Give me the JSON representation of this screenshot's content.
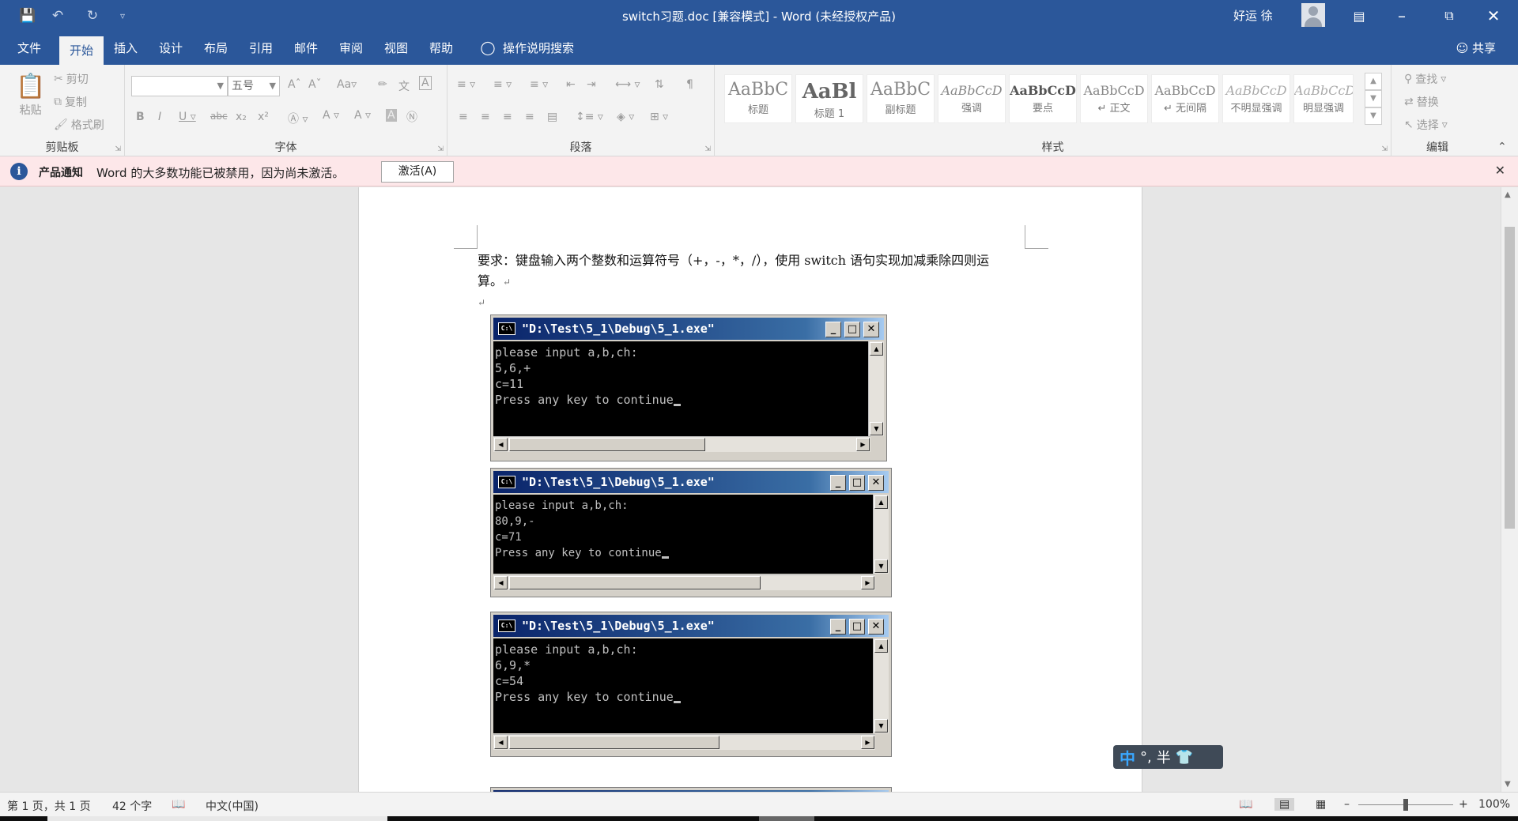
{
  "titlebar": {
    "title": "switch习题.doc [兼容模式]  -  Word (未经授权产品)",
    "user": "好运 徐",
    "qat_icons": [
      "save-icon",
      "undo-icon",
      "redo-icon",
      "customize-icon"
    ]
  },
  "menu": {
    "tabs": [
      "文件",
      "开始",
      "插入",
      "设计",
      "布局",
      "引用",
      "邮件",
      "审阅",
      "视图",
      "帮助"
    ],
    "active": "开始",
    "tellme": "操作说明搜索",
    "share": "共享"
  },
  "ribbon": {
    "clipboard": {
      "label": "剪贴板",
      "paste": "粘贴",
      "cut": "剪切",
      "copy": "复制",
      "format_painter": "格式刷"
    },
    "font": {
      "label": "字体",
      "font_name": "",
      "font_size": "五号"
    },
    "paragraph": {
      "label": "段落"
    },
    "styles": {
      "label": "样式",
      "items": [
        {
          "sample": "AaBbC",
          "name": "标题"
        },
        {
          "sample": "AaBl",
          "name": "标题 1"
        },
        {
          "sample": "AaBbC",
          "name": "副标题"
        },
        {
          "sample": "AaBbCcD",
          "name": "强调"
        },
        {
          "sample": "AaBbCcD",
          "name": "要点"
        },
        {
          "sample": "AaBbCcD",
          "name": "↵ 正文"
        },
        {
          "sample": "AaBbCcD",
          "name": "↵ 无间隔"
        },
        {
          "sample": "AaBbCcD",
          "name": "不明显强调"
        },
        {
          "sample": "AaBbCcD",
          "name": "明显强调"
        }
      ]
    },
    "editing": {
      "label": "编辑",
      "find": "查找",
      "replace": "替换",
      "select": "选择"
    }
  },
  "notice": {
    "title": "产品通知",
    "text": "Word 的大多数功能已被禁用，因为尚未激活。",
    "button": "激活(A)"
  },
  "document": {
    "line1": "要求：键盘输入两个整数和运算符号（+，-，*，/），使用 switch 语句实现加减乘除四则运",
    "line2": "算。",
    "consoles": [
      {
        "title": "\"D:\\Test\\5_1\\Debug\\5_1.exe\"",
        "lines": [
          "please input a,b,ch:",
          "5,6,+",
          "c=11",
          "Press any key to continue"
        ]
      },
      {
        "title": "\"D:\\Test\\5_1\\Debug\\5_1.exe\"",
        "lines": [
          "please input a,b,ch:",
          "80,9,-",
          "c=71",
          "Press any key to continue"
        ]
      },
      {
        "title": "\"D:\\Test\\5_1\\Debug\\5_1.exe\"",
        "lines": [
          "please input a,b,ch:",
          "6,9,*",
          "c=54",
          "Press any key to continue"
        ]
      }
    ]
  },
  "ime": {
    "mode": "中",
    "punct": "°,",
    "width": "半"
  },
  "statusbar": {
    "page": "第 1 页，共 1 页",
    "words": "42 个字",
    "language": "中文(中国)",
    "zoom": "100%"
  }
}
